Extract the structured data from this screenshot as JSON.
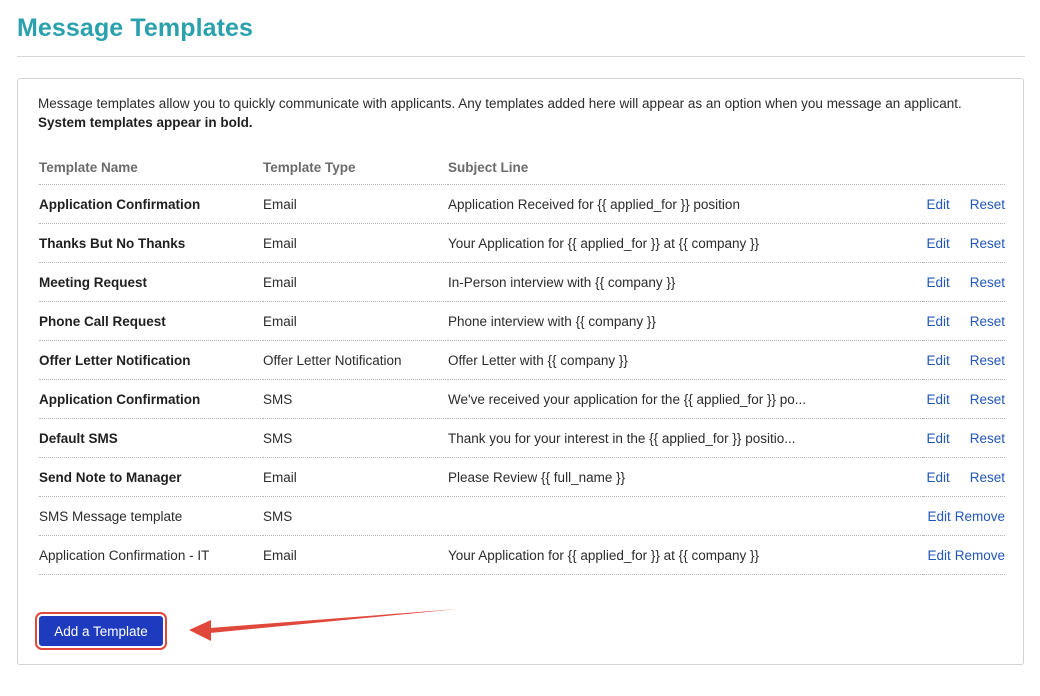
{
  "page": {
    "title": "Message Templates"
  },
  "intro": {
    "text": "Message templates allow you to quickly communicate with applicants. Any templates added here will appear as an option when you message an applicant.",
    "bold_note": "System templates appear in bold."
  },
  "table": {
    "columns": [
      "Template Name",
      "Template Type",
      "Subject Line"
    ],
    "rows": [
      {
        "name": "Application Confirmation",
        "type": "Email",
        "subject": "Application Received for {{ applied_for }} position",
        "system": true,
        "edit": "Edit",
        "action2": "Reset"
      },
      {
        "name": "Thanks But No Thanks",
        "type": "Email",
        "subject": "Your Application for {{ applied_for }} at {{ company }}",
        "system": true,
        "edit": "Edit",
        "action2": "Reset"
      },
      {
        "name": "Meeting Request",
        "type": "Email",
        "subject": "In-Person interview with {{ company }}",
        "system": true,
        "edit": "Edit",
        "action2": "Reset"
      },
      {
        "name": "Phone Call Request",
        "type": "Email",
        "subject": "Phone interview with {{ company }}",
        "system": true,
        "edit": "Edit",
        "action2": "Reset"
      },
      {
        "name": "Offer Letter Notification",
        "type": "Offer Letter Notification",
        "subject": "Offer Letter with {{ company }}",
        "system": true,
        "edit": "Edit",
        "action2": "Reset"
      },
      {
        "name": "Application Confirmation",
        "type": "SMS",
        "subject": "We've received your application for the {{ applied_for }} po...",
        "system": true,
        "edit": "Edit",
        "action2": "Reset"
      },
      {
        "name": "Default SMS",
        "type": "SMS",
        "subject": "Thank you for your interest in the {{ applied_for }} positio...",
        "system": true,
        "edit": "Edit",
        "action2": "Reset"
      },
      {
        "name": "Send Note to Manager",
        "type": "Email",
        "subject": "Please Review {{ full_name }}",
        "system": true,
        "edit": "Edit",
        "action2": "Reset"
      },
      {
        "name": "SMS Message template",
        "type": "SMS",
        "subject": "",
        "system": false,
        "edit": "Edit",
        "action2": "Remove"
      },
      {
        "name": "Application Confirmation - IT",
        "type": "Email",
        "subject": "Your Application for {{ applied_for }} at {{ company }}",
        "system": false,
        "edit": "Edit",
        "action2": "Remove"
      }
    ]
  },
  "add_button": {
    "label": "Add a Template"
  },
  "colors": {
    "title": "#2aa1ad",
    "link": "#2157b8",
    "button": "#1e3bbf",
    "annotation": "#e0483c"
  }
}
